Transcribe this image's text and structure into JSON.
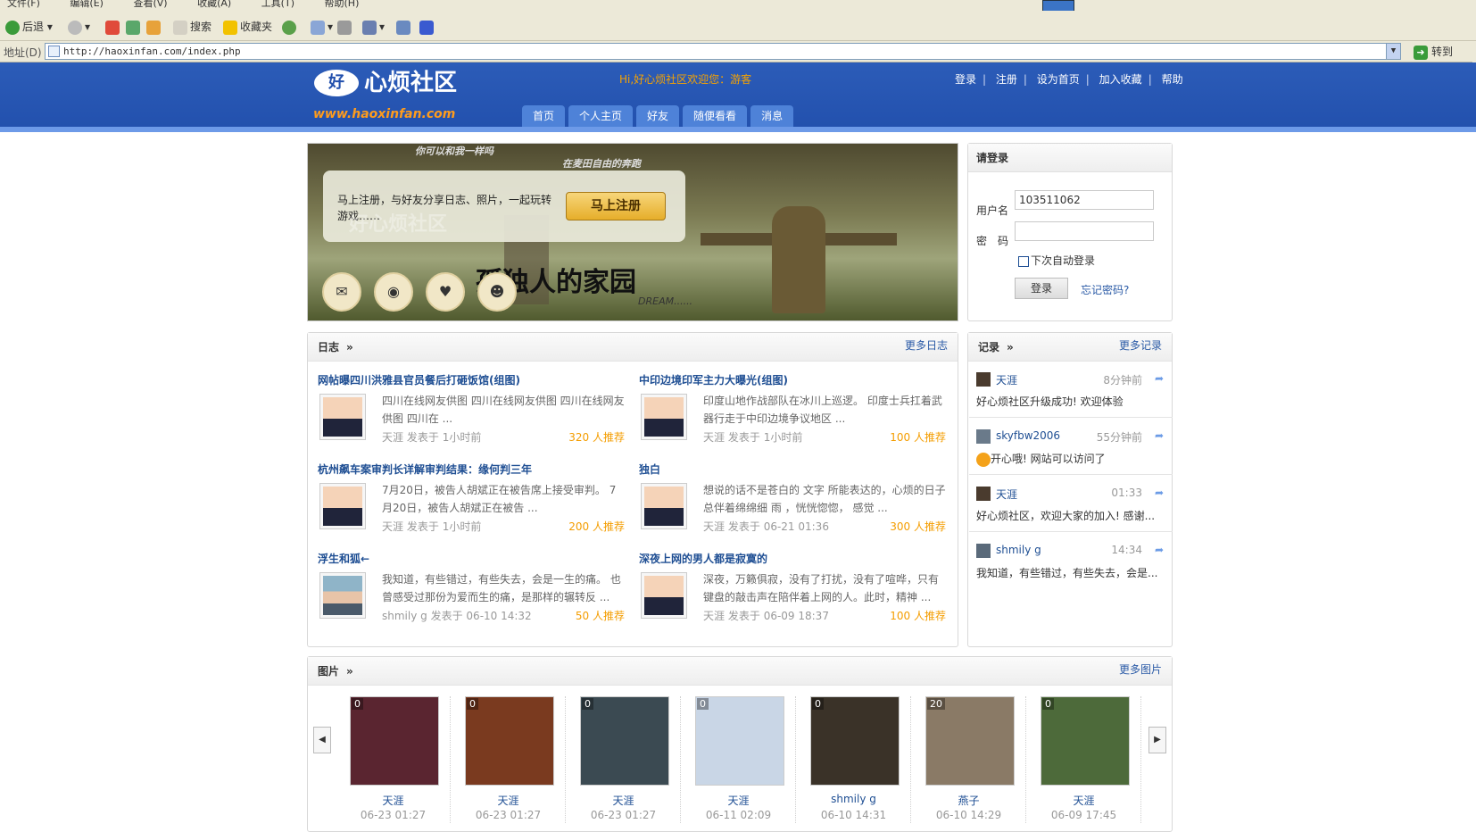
{
  "browser": {
    "menu": [
      "文件(F)",
      "编辑(E)",
      "查看(V)",
      "收藏(A)",
      "工具(T)",
      "帮助(H)"
    ],
    "toolbar": {
      "back": "后退",
      "search": "搜索",
      "favorites": "收藏夹"
    },
    "address_label": "地址(D)",
    "url": "http://haoxinfan.com/index.php",
    "go": "转到"
  },
  "site": {
    "logo_badge": "好",
    "logo_text": "心烦社区",
    "logo_url": "www.haoxinfan.com",
    "welcome": "Hi,好心烦社区欢迎您：游客",
    "toplinks": [
      "登录",
      "注册",
      "设为首页",
      "加入收藏",
      "帮助"
    ],
    "nav": [
      "首页",
      "个人主页",
      "好友",
      "随便看看",
      "消息"
    ]
  },
  "banner": {
    "sky1": "你可以和我一样吗",
    "sky2": "在麦田自由的奔跑",
    "promo": "马上注册，与好友分享日志、照片，一起玩转游戏……",
    "register": "马上注册",
    "watermark": "好心烦社区",
    "title": "孤独人的家园",
    "dream": "DREAM......"
  },
  "login": {
    "title": "请登录",
    "username_label": "用户名",
    "username": "103511062",
    "password_label": "密　码",
    "remember": "下次自动登录",
    "button": "登录",
    "forgot": "忘记密码?"
  },
  "blogs": {
    "title": "日志",
    "more": "更多日志",
    "items": [
      {
        "title": "网帖曝四川洪雅县官员餐后打砸饭馆(组图)",
        "excerpt": "四川在线网友供图 四川在线网友供图 四川在线网友供图 四川在 ...",
        "author": "天涯",
        "posted": "发表于",
        "time": "1小时前",
        "recommend": "320 人推荐"
      },
      {
        "title": "中印边境印军主力大曝光(组图)",
        "excerpt": "印度山地作战部队在冰川上巡逻。 印度士兵扛着武器行走于中印边境争议地区 ...",
        "author": "天涯",
        "posted": "发表于",
        "time": "1小时前",
        "recommend": "100 人推荐"
      },
      {
        "title": "杭州飙车案审判长详解审判结果：缘何判三年",
        "excerpt": "7月20日，被告人胡斌正在被告席上接受审判。 7月20日，被告人胡斌正在被告 ...",
        "author": "天涯",
        "posted": "发表于",
        "time": "1小时前",
        "recommend": "200 人推荐"
      },
      {
        "title": "独白",
        "excerpt": "想说的话不是苍白的 文字 所能表达的，心烦的日子总伴着绵绵细 雨 ，恍恍惚惚， 感觉 ...",
        "author": "天涯",
        "posted": "发表于",
        "time": "06-21 01:36",
        "recommend": "300 人推荐"
      },
      {
        "title": "浮生和狐←",
        "excerpt": "我知道，有些错过，有些失去，会是一生的痛。 也曾感受过那份为爱而生的痛，是那样的辗转反 ...",
        "author": "shmily g",
        "posted": "发表于",
        "time": "06-10 14:32",
        "recommend": "50 人推荐"
      },
      {
        "title": "深夜上网的男人都是寂寞的",
        "excerpt": "深夜，万籁俱寂，没有了打扰，没有了喧哗，只有键盘的敲击声在陪伴着上网的人。此时，精神 ...",
        "author": "天涯",
        "posted": "发表于",
        "time": "06-09 18:37",
        "recommend": "100 人推荐"
      }
    ]
  },
  "records": {
    "title": "记录",
    "more": "更多记录",
    "items": [
      {
        "name": "天涯",
        "time": "8分钟前",
        "content": "好心烦社区升级成功! 欢迎体验"
      },
      {
        "name": "skyfbw2006",
        "time": "55分钟前",
        "content": "开心哦! 网站可以访问了"
      },
      {
        "name": "天涯",
        "time": "01:33",
        "content": "好心烦社区，欢迎大家的加入! 感谢..."
      },
      {
        "name": "shmily g",
        "time": "14:34",
        "content": "我知道，有些错过，有些失去，会是..."
      }
    ]
  },
  "photos": {
    "title": "图片",
    "more": "更多图片",
    "items": [
      {
        "count": "0",
        "name": "天涯",
        "date": "06-23 01:27",
        "color": "#5a2530"
      },
      {
        "count": "0",
        "name": "天涯",
        "date": "06-23 01:27",
        "color": "#7a3a1f"
      },
      {
        "count": "0",
        "name": "天涯",
        "date": "06-23 01:27",
        "color": "#3b4a52"
      },
      {
        "count": "0",
        "name": "天涯",
        "date": "06-11 02:09",
        "color": "#c9d6e6"
      },
      {
        "count": "0",
        "name": "shmily g",
        "date": "06-10 14:31",
        "color": "#3a3228"
      },
      {
        "count": "20",
        "name": "燕子",
        "date": "06-10 14:29",
        "color": "#8a7a66"
      },
      {
        "count": "0",
        "name": "天涯",
        "date": "06-09 17:45",
        "color": "#4d6a3a"
      }
    ]
  }
}
